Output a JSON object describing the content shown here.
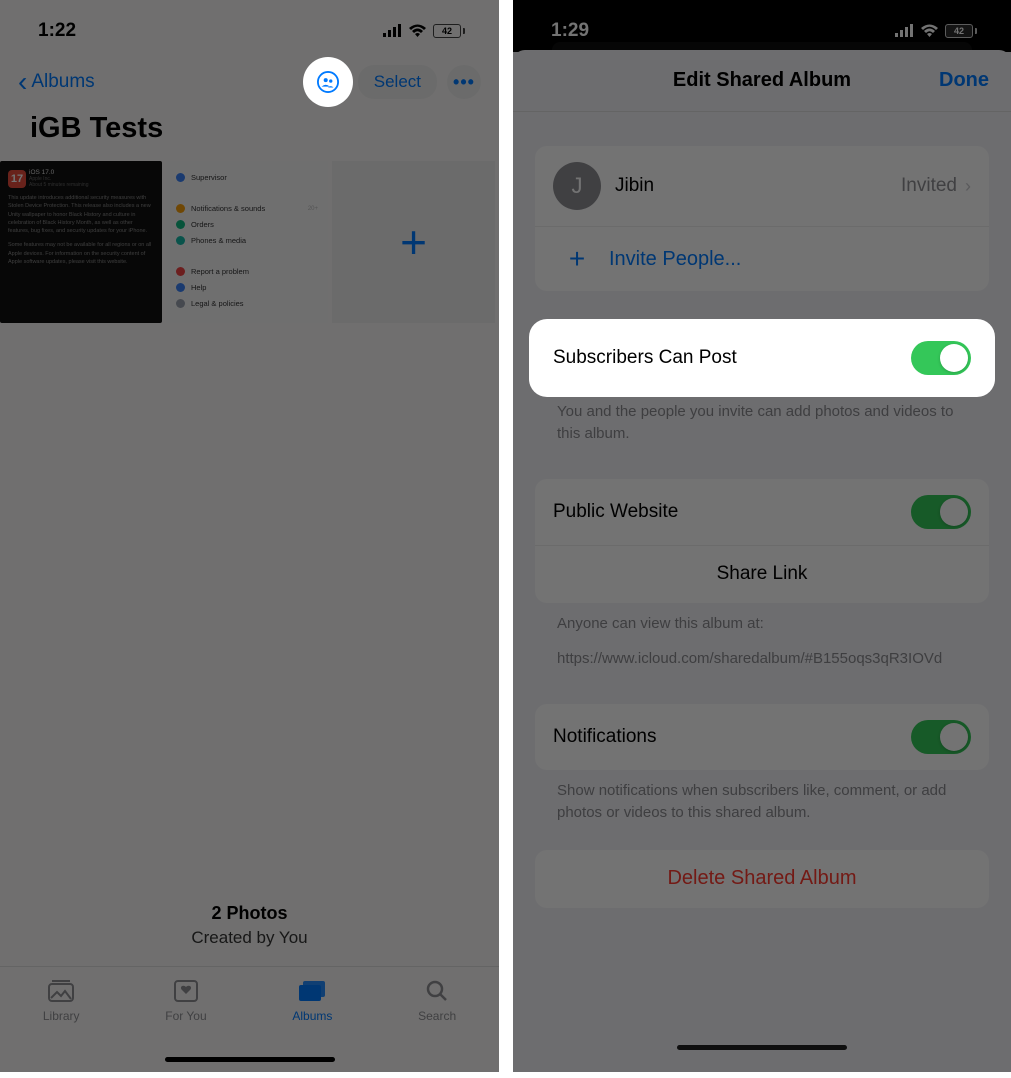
{
  "left": {
    "status": {
      "time": "1:22",
      "battery": "42"
    },
    "nav": {
      "back_label": "Albums",
      "select_label": "Select"
    },
    "title": "iGB Tests",
    "thumb1": {
      "badge": "17",
      "title": "iOS 17.0",
      "subtitle": "Apple Inc.",
      "subtitle2": "About 5 minutes remaining",
      "body": "This update introduces additional security measures with Stolen Device Protection. This release also includes a new Unity wallpaper to honor Black History and culture in celebration of Black History Month, as well as other features, bug fixes, and security updates for your iPhone.",
      "body2": "Some features may not be available for all regions or on all Apple devices. For information on the security content of Apple software updates, please visit this website."
    },
    "thumb2": {
      "items": [
        {
          "label": "Supervisor",
          "color": "blue"
        },
        {
          "label": "Notifications & sounds",
          "color": "orange",
          "cnt": "20+"
        },
        {
          "label": "Orders",
          "color": "green"
        },
        {
          "label": "Phones & media",
          "color": "teal"
        }
      ],
      "items2": [
        {
          "label": "Report a problem",
          "color": "red"
        },
        {
          "label": "Help",
          "color": "blue"
        },
        {
          "label": "Legal & policies",
          "color": "gray"
        }
      ]
    },
    "footer": {
      "line1": "2 Photos",
      "line2": "Created by You"
    },
    "tabs": [
      {
        "label": "Library"
      },
      {
        "label": "For You"
      },
      {
        "label": "Albums"
      },
      {
        "label": "Search"
      }
    ]
  },
  "right": {
    "status": {
      "time": "1:29",
      "battery": "42"
    },
    "sheet_title": "Edit Shared Album",
    "done": "Done",
    "member": {
      "initial": "J",
      "name": "Jibin",
      "status": "Invited"
    },
    "invite": "Invite People...",
    "subscribers_label": "Subscribers Can Post",
    "subscribers_hint": "You and the people you invite can add photos and videos to this album.",
    "public_label": "Public Website",
    "share_link": "Share Link",
    "public_hint1": "Anyone can view this album at:",
    "public_hint2": "https://www.icloud.com/sharedalbum/#B155oqs3qR3IOVd",
    "notif_label": "Notifications",
    "notif_hint": "Show notifications when subscribers like, comment, or add photos or videos to this shared album.",
    "delete": "Delete Shared Album"
  }
}
